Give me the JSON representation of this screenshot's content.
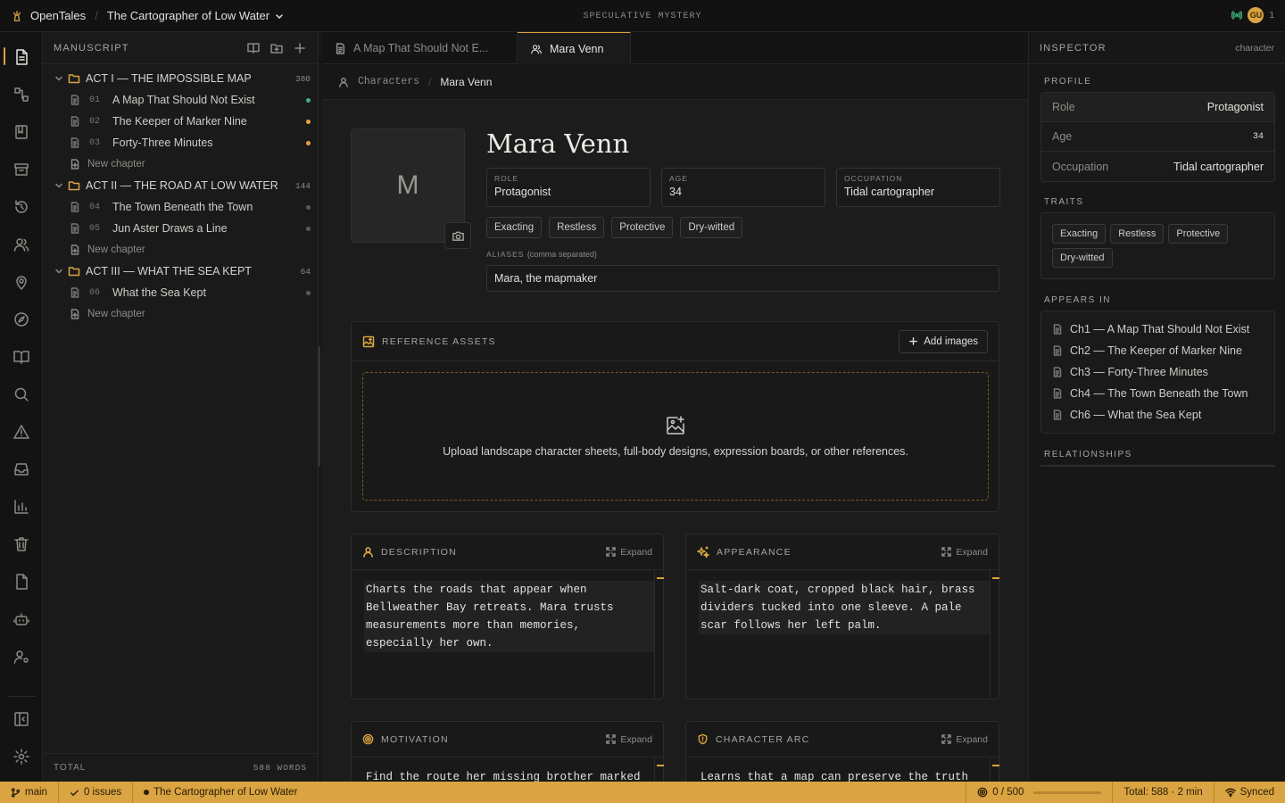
{
  "app": {
    "name": "OpenTales",
    "project": "The Cartographer of Low Water",
    "genre": "SPECULATIVE MYSTERY",
    "user_initials": "GU",
    "user_count": "1"
  },
  "manuscript": {
    "title": "MANUSCRIPT",
    "acts": [
      {
        "name": "ACT I — THE IMPOSSIBLE MAP",
        "count": "380",
        "chapters": [
          {
            "num": "01",
            "title": "A Map That Should Not Exist",
            "status_color": "#3fb27f"
          },
          {
            "num": "02",
            "title": "The Keeper of Marker Nine",
            "status_color": "#e6a23c"
          },
          {
            "num": "03",
            "title": "Forty-Three Minutes",
            "status_color": "#e6a23c"
          }
        ]
      },
      {
        "name": "ACT II — THE ROAD AT LOW WATER",
        "count": "144",
        "chapters": [
          {
            "num": "04",
            "title": "The Town Beneath the Town",
            "status_color": "#5a5a5a"
          },
          {
            "num": "05",
            "title": "Jun Aster Draws a Line",
            "status_color": "#5a5a5a"
          }
        ]
      },
      {
        "name": "ACT III — WHAT THE SEA KEPT",
        "count": "64",
        "chapters": [
          {
            "num": "06",
            "title": "What the Sea Kept",
            "status_color": "#5a5a5a"
          }
        ]
      }
    ],
    "new_chapter": "New chapter",
    "total_label": "TOTAL",
    "total_words": "588 WORDS"
  },
  "tabs": [
    {
      "label": "A Map That Should Not E..."
    },
    {
      "label": "Mara Venn"
    }
  ],
  "breadcrumb": {
    "section": "Characters",
    "current": "Mara Venn"
  },
  "character": {
    "initial": "M",
    "name": "Mara Venn",
    "fields": [
      {
        "label": "ROLE",
        "value": "Protagonist"
      },
      {
        "label": "AGE",
        "value": "34"
      },
      {
        "label": "OCCUPATION",
        "value": "Tidal cartographer"
      }
    ],
    "traits": [
      "Exacting",
      "Restless",
      "Protective",
      "Dry-witted"
    ],
    "aliases_label": "ALIASES",
    "aliases_hint": "(comma separated)",
    "aliases": "Mara, the mapmaker"
  },
  "assets": {
    "title": "REFERENCE ASSETS",
    "add_label": "Add images",
    "drop_text": "Upload landscape character sheets, full-body designs, expression boards, or other references."
  },
  "sections": {
    "expand": "Expand",
    "description": {
      "title": "DESCRIPTION",
      "lines": [
        "Charts the roads that appear when",
        "Bellweather Bay retreats. Mara trusts",
        "measurements more than memories,",
        "especially her own."
      ]
    },
    "appearance": {
      "title": "APPEARANCE",
      "lines": [
        "Salt-dark coat, cropped black hair, brass",
        "dividers tucked into one sleeve. A pale",
        "scar follows her left palm."
      ]
    },
    "motivation": {
      "title": "MOTIVATION",
      "lines": [
        "Find the route her missing brother marked"
      ]
    },
    "arc": {
      "title": "CHARACTER ARC",
      "lines": [
        "Learns that a map can preserve the truth"
      ]
    }
  },
  "inspector": {
    "title": "INSPECTOR",
    "kind": "character",
    "profile_label": "PROFILE",
    "profile": [
      {
        "key": "Role",
        "value": "Protagonist"
      },
      {
        "key": "Age",
        "value": "34"
      },
      {
        "key": "Occupation",
        "value": "Tidal cartographer"
      }
    ],
    "traits_label": "TRAITS",
    "traits": [
      "Exacting",
      "Restless",
      "Protective",
      "Dry-witted"
    ],
    "appears_label": "APPEARS IN",
    "appears": [
      "Ch1 — A Map That Should Not Exist",
      "Ch2 — The Keeper of Marker Nine",
      "Ch3 — Forty-Three Minutes",
      "Ch4 — The Town Beneath the Town",
      "Ch6 — What the Sea Kept"
    ],
    "relationships_label": "RELATIONSHIPS"
  },
  "status": {
    "branch": "main",
    "issues": "0 issues",
    "project": "The Cartographer of Low Water",
    "goal": "0 / 500",
    "goal_progress": 0,
    "total": "Total: 588 · 2 min",
    "sync": "Synced"
  },
  "colors": {
    "accent": "#d9a441",
    "background": "#171717"
  }
}
